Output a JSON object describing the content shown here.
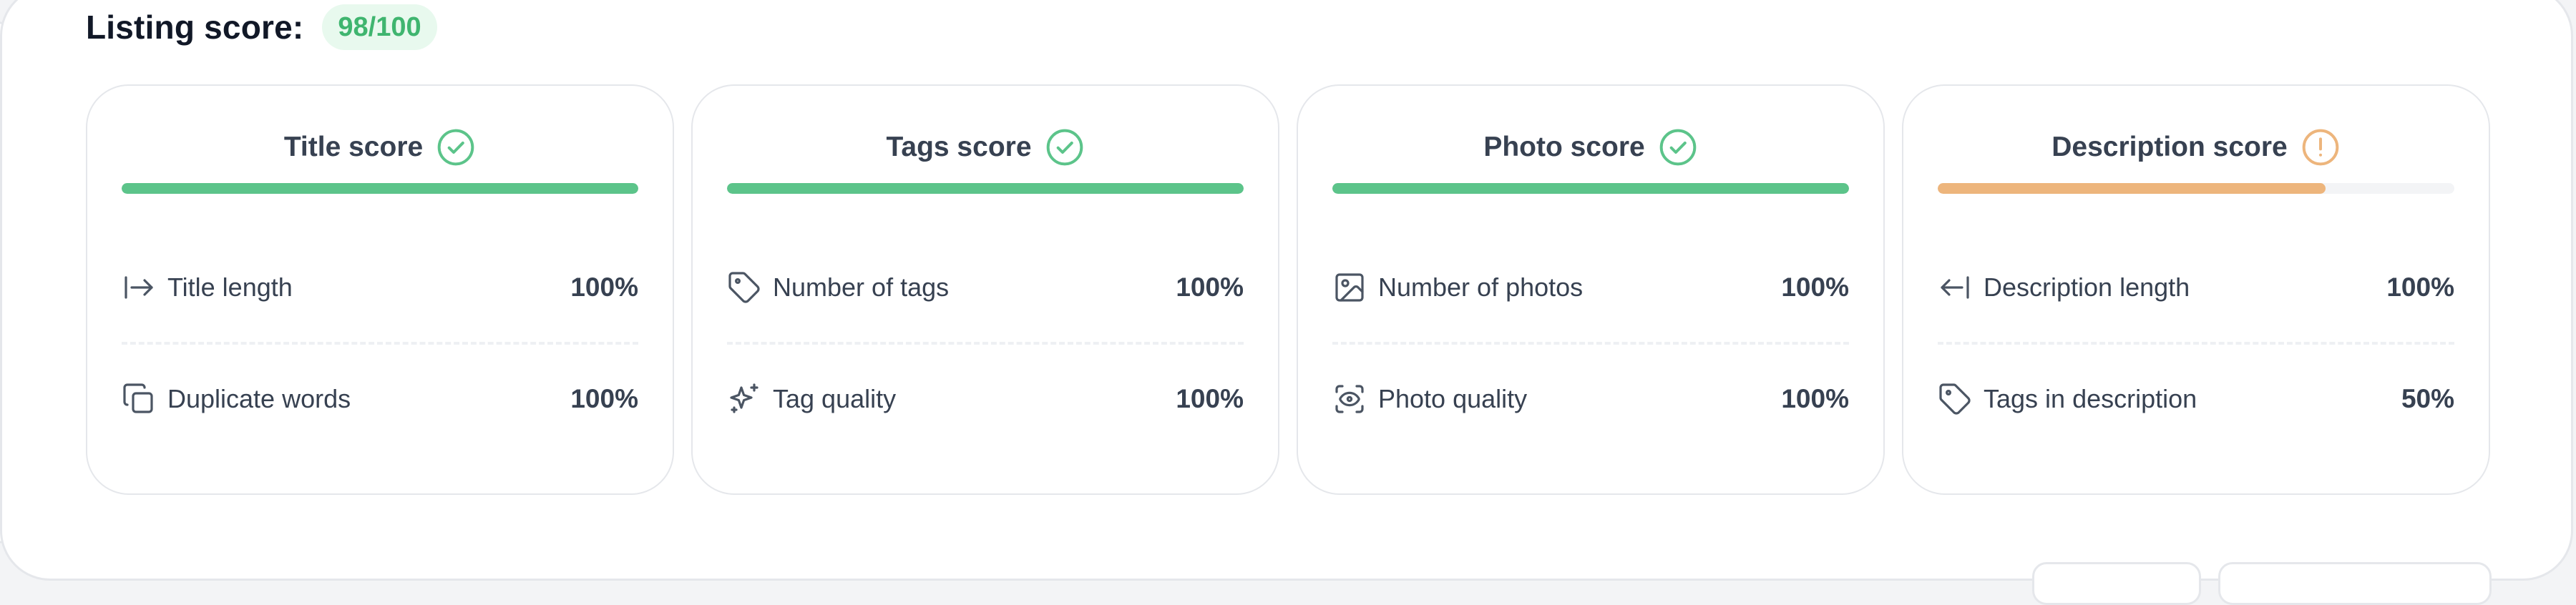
{
  "header": {
    "label": "Listing score:",
    "score": "98/100"
  },
  "colors": {
    "success": "#5cc48a",
    "warning": "#edb57c",
    "score_pill_bg": "#e8f9ee",
    "score_pill_text": "#3fb56f"
  },
  "cards": [
    {
      "title": "Title score",
      "status": "success",
      "status_icon": "check-circle-icon",
      "progress": 1.0,
      "metrics": [
        {
          "icon": "arrow-right-to-line-icon",
          "label": "Title length",
          "value": "100%"
        },
        {
          "icon": "copy-icon",
          "label": "Duplicate words",
          "value": "100%"
        }
      ]
    },
    {
      "title": "Tags score",
      "status": "success",
      "status_icon": "check-circle-icon",
      "progress": 1.0,
      "metrics": [
        {
          "icon": "tag-icon",
          "label": "Number of tags",
          "value": "100%"
        },
        {
          "icon": "sparkles-icon",
          "label": "Tag quality",
          "value": "100%"
        }
      ]
    },
    {
      "title": "Photo score",
      "status": "success",
      "status_icon": "check-circle-icon",
      "progress": 1.0,
      "metrics": [
        {
          "icon": "image-icon",
          "label": "Number of photos",
          "value": "100%"
        },
        {
          "icon": "scan-eye-icon",
          "label": "Photo quality",
          "value": "100%"
        }
      ]
    },
    {
      "title": "Description score",
      "status": "warning",
      "status_icon": "alert-circle-icon",
      "progress": 0.75,
      "metrics": [
        {
          "icon": "arrow-left-to-line-icon",
          "label": "Description length",
          "value": "100%"
        },
        {
          "icon": "tag-icon",
          "label": "Tags in description",
          "value": "50%"
        }
      ]
    }
  ]
}
